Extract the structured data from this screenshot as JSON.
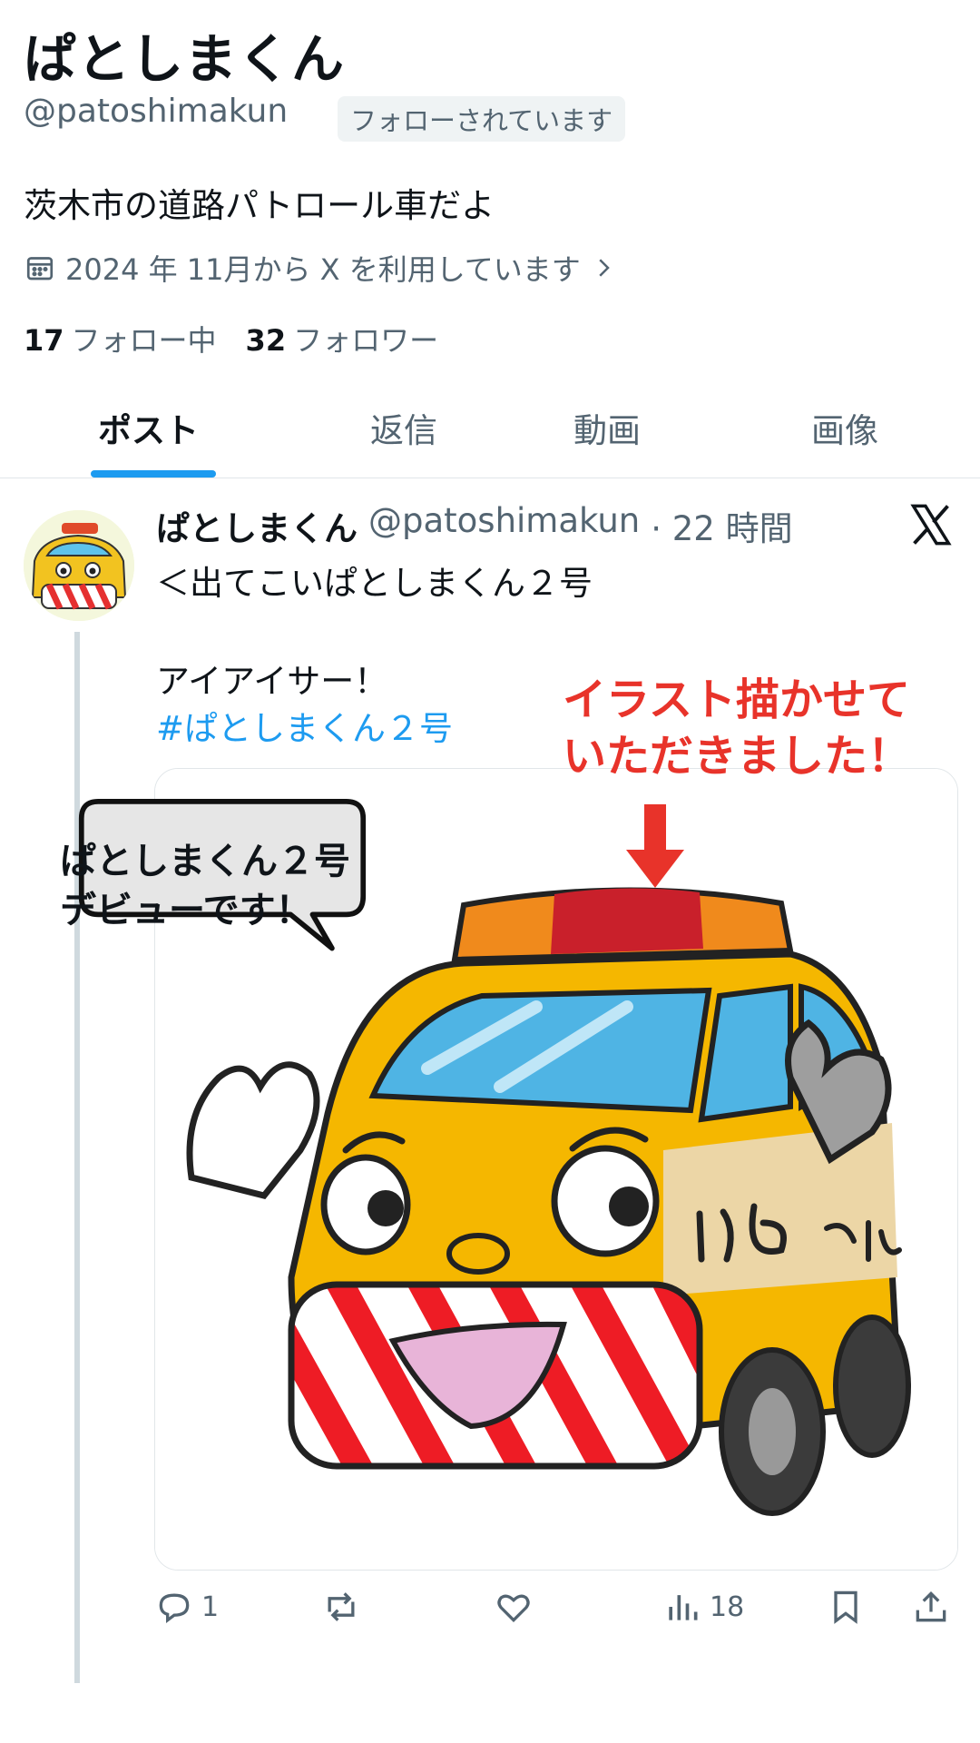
{
  "profile": {
    "display_name": "ぱとしまくん",
    "handle": "@patoshimakun",
    "follows_you": "フォローされています",
    "bio": "茨木市の道路パトロール車だよ",
    "joined": "2024 年 11月から X を利用しています",
    "following_count": "17",
    "following_label": "フォロー中",
    "followers_count": "32",
    "followers_label": "フォロワー"
  },
  "tabs": [
    {
      "label": "ポスト",
      "active": true
    },
    {
      "label": "返信"
    },
    {
      "label": "動画"
    },
    {
      "label": "画像"
    }
  ],
  "post": {
    "author_name": "ぱとしまくん",
    "author_handle": "@patoshimakun",
    "time": "· 22 時間",
    "line1": "＜出てこいぱとしまくん２号",
    "line2": "アイアイサー！",
    "hashtag": "#ぱとしまくん２号",
    "actions": {
      "replies": "1",
      "views": "18"
    }
  },
  "annotation": {
    "line1": "イラスト描かせて",
    "line2": "いただきました！"
  },
  "bubble": {
    "line1": "ぱとしまくん２号",
    "line2": "デビューです！"
  },
  "icons": [
    "calendar-icon",
    "chevron-right-icon",
    "x-logo-icon",
    "reply-icon",
    "repost-icon",
    "like-icon",
    "views-icon",
    "bookmark-icon",
    "share-icon"
  ],
  "colors": {
    "accent": "#1d9bf0",
    "annotation_red": "#e8332a",
    "secondary_text": "#536471"
  }
}
